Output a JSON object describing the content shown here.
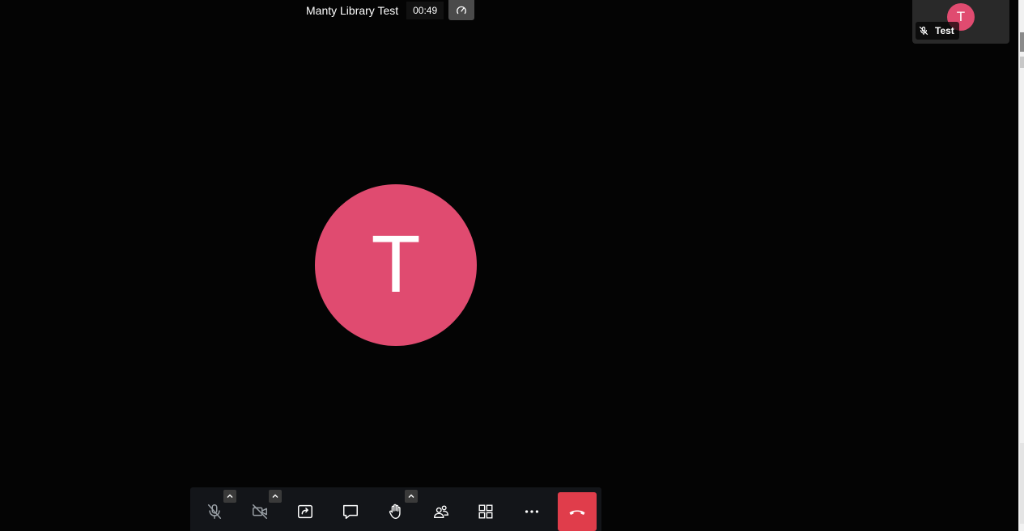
{
  "meeting": {
    "subject": "Manty Library Test",
    "timer": "00:49"
  },
  "main_participant": {
    "initial": "T"
  },
  "local_participant": {
    "initial": "T",
    "name": "Test"
  },
  "toolbar": {
    "buttons": [
      {
        "name": "microphone-button",
        "icon": "microphone-muted-icon"
      },
      {
        "name": "camera-button",
        "icon": "camera-off-icon"
      },
      {
        "name": "share-screen-button",
        "icon": "share-screen-icon"
      },
      {
        "name": "chat-button",
        "icon": "chat-icon"
      },
      {
        "name": "raise-hand-button",
        "icon": "hand-icon"
      },
      {
        "name": "participants-button",
        "icon": "participants-icon"
      },
      {
        "name": "tile-view-button",
        "icon": "tile-view-icon"
      },
      {
        "name": "more-button",
        "icon": "more-icon"
      },
      {
        "name": "hangup-button",
        "icon": "hangup-icon"
      }
    ]
  },
  "colors": {
    "avatar": "#e04b70",
    "hangup": "#e03d4b",
    "toolbar_bg": "#131519",
    "background": "#040404"
  }
}
